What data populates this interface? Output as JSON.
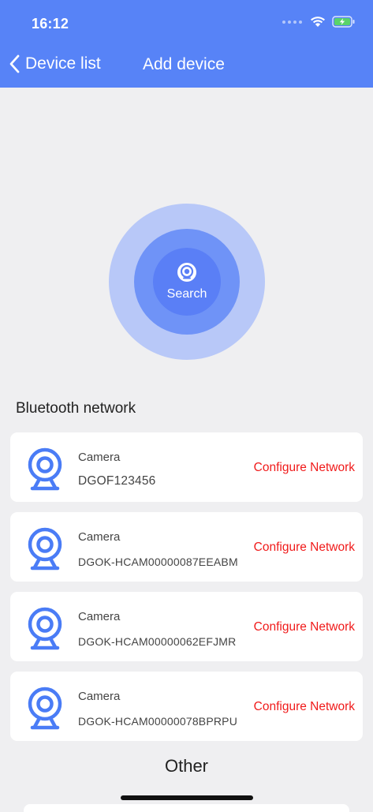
{
  "status_bar": {
    "time": "16:12"
  },
  "nav": {
    "back_label": "Device list",
    "title": "Add device"
  },
  "radar": {
    "search_label": "Search"
  },
  "bluetooth": {
    "section_title": "Bluetooth network",
    "devices": [
      {
        "name": "Camera",
        "id": "DGOF123456",
        "action": "Configure Network"
      },
      {
        "name": "Camera",
        "id": "DGOK-HCAM00000087EEABM",
        "action": "Configure Network"
      },
      {
        "name": "Camera",
        "id": "DGOK-HCAM00000062EFJMR",
        "action": "Configure Network"
      },
      {
        "name": "Camera",
        "id": "DGOK-HCAM00000078BPRPU",
        "action": "Configure Network"
      }
    ]
  },
  "other": {
    "section_title": "Other"
  },
  "colors": {
    "header": "#5783f7",
    "accent": "#4a7cf6",
    "action": "#f01a1a",
    "background": "#efeff1"
  },
  "icons": [
    "chevron-left-icon",
    "wifi-icon",
    "battery-charging-icon",
    "camera-icon",
    "webcam-icon"
  ]
}
